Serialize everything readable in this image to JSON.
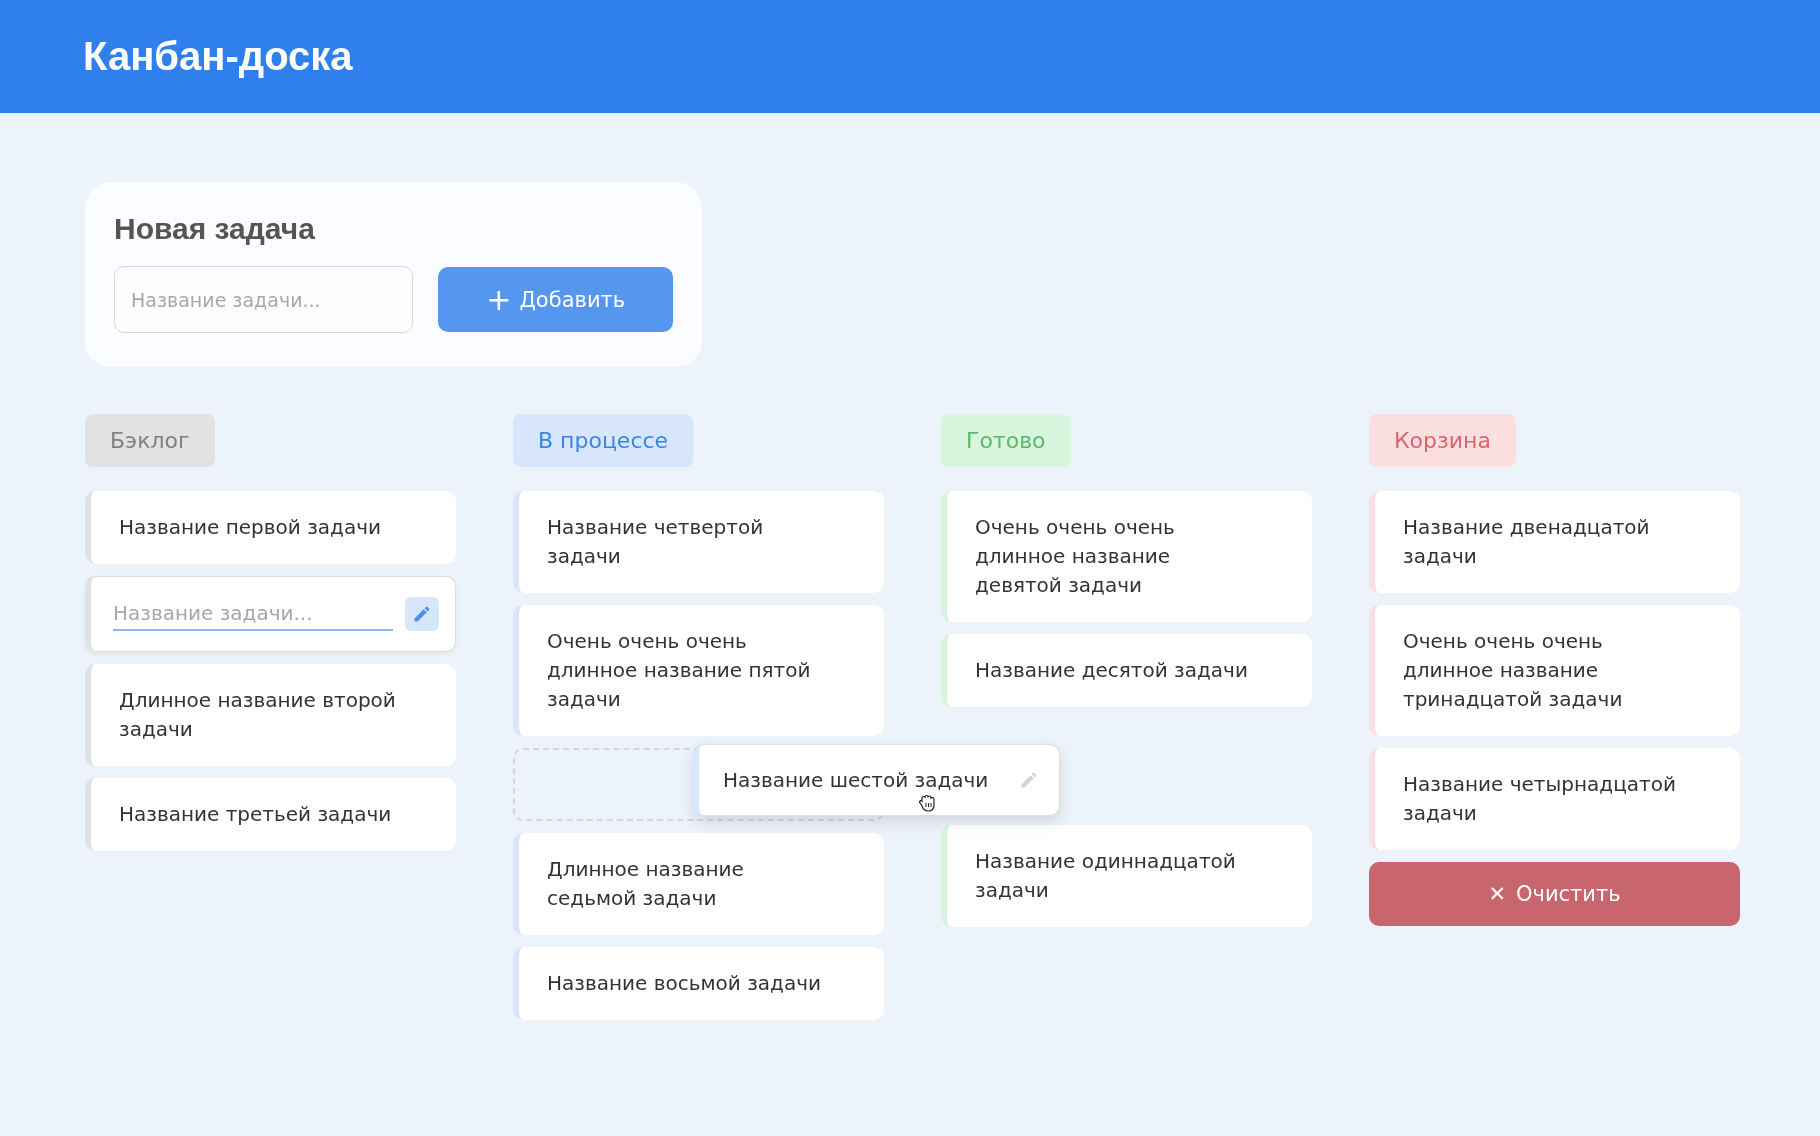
{
  "header": {
    "title": "Канбан-доска"
  },
  "new_task": {
    "title": "Новая задача",
    "placeholder": "Название задачи...",
    "button_icon": "+",
    "button": "Добавить"
  },
  "columns": [
    {
      "title": "Бэклог",
      "kind": "backlog",
      "tasks": [
        {
          "kind": "card",
          "text": "Название первой задачи"
        },
        {
          "kind": "editing",
          "placeholder": "Название задачи..."
        },
        {
          "kind": "card",
          "text": "Длинное название второй задачи"
        },
        {
          "kind": "card",
          "text": "Название третьей задачи"
        }
      ]
    },
    {
      "title": "В процессе",
      "kind": "progress",
      "tasks": [
        {
          "kind": "card",
          "text": "Название четвертой задачи"
        },
        {
          "kind": "card",
          "text": "Очень очень очень длинное название пятой задачи"
        },
        {
          "kind": "drop-slot"
        },
        {
          "kind": "card",
          "text": "Длинное название седьмой задачи"
        },
        {
          "kind": "card",
          "text": "Название восьмой задачи"
        }
      ]
    },
    {
      "title": "Готово",
      "kind": "done",
      "tasks": [
        {
          "kind": "card",
          "text": "Очень очень очень длинное название девятой задачи"
        },
        {
          "kind": "card",
          "text": "Название десятой задачи"
        },
        {
          "kind": "gap"
        },
        {
          "kind": "card",
          "text": "Название одиннадцатой задачи"
        }
      ]
    },
    {
      "title": "Корзина",
      "kind": "trash",
      "tasks": [
        {
          "kind": "card",
          "text": "Название двенадцатой задачи"
        },
        {
          "kind": "card",
          "text": "Очень очень очень длинное название тринадцатой задачи"
        },
        {
          "kind": "card",
          "text": "Название четырнадцатой задачи"
        }
      ],
      "clear_button": {
        "icon": "✕",
        "label": "Очистить"
      }
    }
  ],
  "dragged_card": {
    "text": "Название шестой задачи",
    "kind": "progress"
  }
}
